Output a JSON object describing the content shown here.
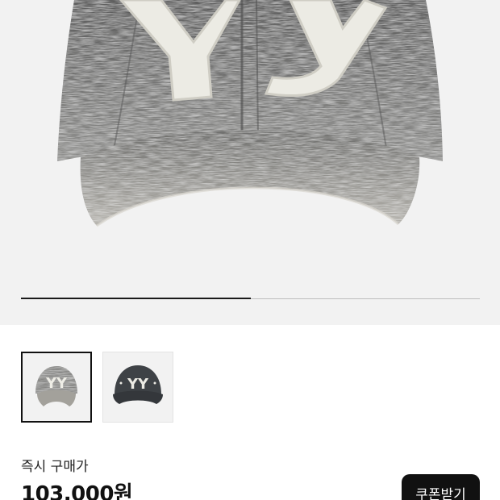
{
  "product": {
    "image_alt": "washed grey baseball cap with YY logo",
    "gallery_progress_fraction": 0.5
  },
  "thumbnails": [
    {
      "label": "washed grey cap",
      "selected": true
    },
    {
      "label": "charcoal cap",
      "selected": false
    }
  ],
  "price": {
    "label": "즉시 구매가",
    "amount": "103,000원"
  },
  "coupon": {
    "label": "쿠폰받기"
  },
  "colors": {
    "hero_bg": "#f2f2f2",
    "cap_washed": "#8a8a8a",
    "cap_charcoal": "#3e4246",
    "logo_cream": "#ecebe4",
    "button_bg": "#111111"
  }
}
